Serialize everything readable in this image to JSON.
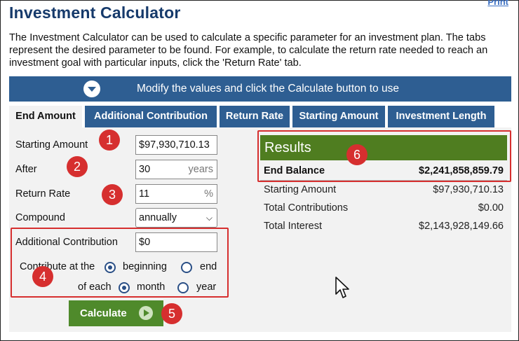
{
  "header": {
    "title": "Investment Calculator",
    "print_link": "Print",
    "intro": "The Investment Calculator can be used to calculate a specific parameter for an investment plan. The tabs represent the desired parameter to be found. For example, to calculate the return rate needed to reach an investment goal with particular inputs, click the 'Return Rate' tab."
  },
  "banner": {
    "text": "Modify the values and click the Calculate button to use"
  },
  "tabs": [
    {
      "label": "End Amount",
      "active": true
    },
    {
      "label": "Additional Contribution",
      "active": false
    },
    {
      "label": "Return Rate",
      "active": false
    },
    {
      "label": "Starting Amount",
      "active": false
    },
    {
      "label": "Investment Length",
      "active": false
    }
  ],
  "form": {
    "starting_amount_label": "Starting Amount",
    "starting_amount_value": "$97,930,710.13",
    "after_label": "After",
    "after_value": "30",
    "after_unit": "years",
    "return_rate_label": "Return Rate",
    "return_rate_value": "11",
    "return_rate_unit": "%",
    "compound_label": "Compound",
    "compound_value": "annually",
    "additional_contribution_label": "Additional Contribution",
    "additional_contribution_value": "$0",
    "contribute_at_label": "Contribute at the",
    "contribute_at_options": [
      "beginning",
      "end"
    ],
    "contribute_at_selected": "beginning",
    "of_each_label": "of each",
    "of_each_options": [
      "month",
      "year"
    ],
    "of_each_selected": "month"
  },
  "calculate_button": {
    "label": "Calculate"
  },
  "results": {
    "title": "Results",
    "end_balance_label": "End Balance",
    "end_balance_value": "$2,241,858,859.79",
    "rows": [
      {
        "label": "Starting Amount",
        "value": "$97,930,710.13"
      },
      {
        "label": "Total Contributions",
        "value": "$0.00"
      },
      {
        "label": "Total Interest",
        "value": "$2,143,928,149.66"
      }
    ]
  },
  "annotations": [
    "1",
    "2",
    "3",
    "4",
    "5",
    "6"
  ],
  "colors": {
    "accent_blue": "#2e5e92",
    "results_green": "#4f7d20",
    "button_green": "#4f8a2b",
    "annotation_red": "#d62f2f"
  }
}
